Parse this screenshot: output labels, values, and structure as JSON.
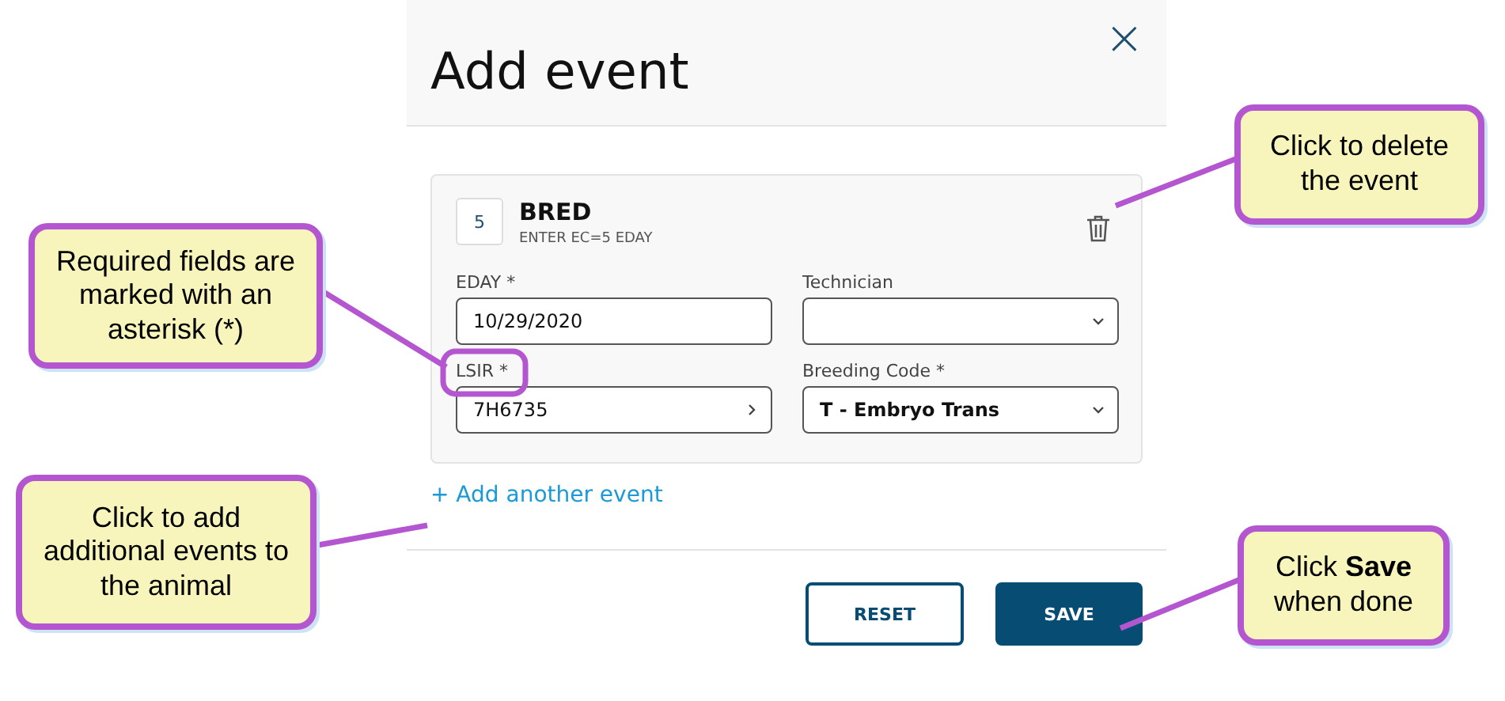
{
  "dialog": {
    "title": "Add event",
    "close": "×"
  },
  "event": {
    "number": "5",
    "name": "BRED",
    "instruction": "ENTER EC=5 EDAY",
    "fields": [
      {
        "label": "EDAY *",
        "value": "10/29/2020",
        "kind": "text"
      },
      {
        "label": "Technician",
        "kind": "select"
      },
      {
        "label": "LSIR *",
        "value": "7H6735",
        "kind": "lookup"
      },
      {
        "label": "Breeding Code *",
        "value": "T - Embryo Trans",
        "kind": "select"
      }
    ]
  },
  "add_link": "+ Add another event",
  "buttons": [
    {
      "label": "RESET",
      "kind": "secondary"
    },
    {
      "label": "SAVE",
      "kind": "primary"
    }
  ],
  "annotations": [
    {
      "text": "Required fields are marked with an asterisk (*)"
    },
    {
      "text": "Click to add additional events to the animal"
    },
    {
      "text": "Click to delete the event"
    },
    {
      "text": "Click **Save** when done"
    }
  ]
}
